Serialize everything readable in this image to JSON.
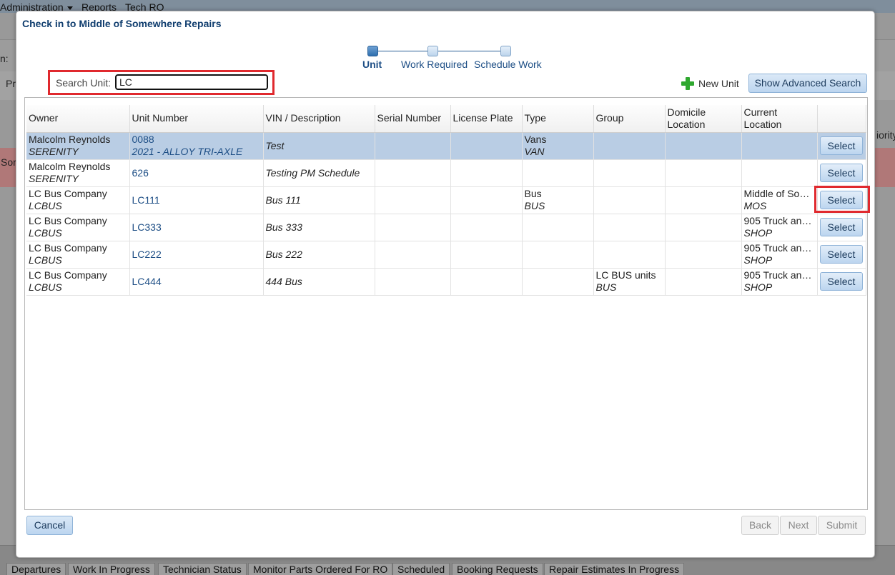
{
  "background": {
    "menu": [
      "Administration",
      "Reports",
      "Tech RO"
    ],
    "left_fragments": [
      "n:",
      "Pri",
      "Sor"
    ],
    "right_fragment": "iority",
    "bottom_tabs": [
      "Departures",
      "Work In Progress",
      "Technician Status",
      "Monitor Parts Ordered For RO",
      "Scheduled",
      "Booking Requests",
      "Repair Estimates In Progress"
    ]
  },
  "dialog": {
    "title": "Check in to Middle of Somewhere Repairs",
    "steps": [
      "Unit",
      "Work Required",
      "Schedule Work"
    ],
    "active_step": 0,
    "search": {
      "label": "Search Unit:",
      "value": "LC"
    },
    "new_unit_label": "New Unit",
    "advanced_search_label": "Show Advanced Search",
    "columns": [
      "Owner",
      "Unit Number",
      "VIN / Description",
      "Serial Number",
      "License Plate",
      "Type",
      "Group",
      "Domicile Location",
      "Current Location",
      ""
    ],
    "rows": [
      {
        "owner": "Malcolm Reynolds",
        "owner_code": "SERENITY",
        "unit": "0088",
        "unit_sub": "2021 - ALLOY TRI-AXLE",
        "vin": "Test",
        "serial": "",
        "plate": "",
        "type": "Vans",
        "type_code": "VAN",
        "group": "",
        "group_code": "",
        "domicile": "",
        "location": "",
        "location_code": "",
        "select": "Select"
      },
      {
        "owner": "Malcolm Reynolds",
        "owner_code": "SERENITY",
        "unit": "626",
        "unit_sub": "",
        "vin": "Testing PM Schedule",
        "serial": "",
        "plate": "",
        "type": "",
        "type_code": "",
        "group": "",
        "group_code": "",
        "domicile": "",
        "location": "",
        "location_code": "",
        "select": "Select"
      },
      {
        "owner": "LC Bus Company",
        "owner_code": "LCBUS",
        "unit": "LC111",
        "unit_sub": "",
        "vin": "Bus 111",
        "serial": "",
        "plate": "",
        "type": "Bus",
        "type_code": "BUS",
        "group": "",
        "group_code": "",
        "domicile": "",
        "location": "Middle of Som...",
        "location_code": "MOS",
        "select": "Select"
      },
      {
        "owner": "LC Bus Company",
        "owner_code": "LCBUS",
        "unit": "LC333",
        "unit_sub": "",
        "vin": "Bus 333",
        "serial": "",
        "plate": "",
        "type": "",
        "type_code": "",
        "group": "",
        "group_code": "",
        "domicile": "",
        "location": "905 Truck and...",
        "location_code": "SHOP",
        "select": "Select"
      },
      {
        "owner": "LC Bus Company",
        "owner_code": "LCBUS",
        "unit": "LC222",
        "unit_sub": "",
        "vin": "Bus 222",
        "serial": "",
        "plate": "",
        "type": "",
        "type_code": "",
        "group": "",
        "group_code": "",
        "domicile": "",
        "location": "905 Truck and...",
        "location_code": "SHOP",
        "select": "Select"
      },
      {
        "owner": "LC Bus Company",
        "owner_code": "LCBUS",
        "unit": "LC444",
        "unit_sub": "",
        "vin": "444 Bus",
        "serial": "",
        "plate": "",
        "type": "",
        "type_code": "",
        "group": "LC BUS units",
        "group_code": "BUS",
        "domicile": "",
        "location": "905 Truck and...",
        "location_code": "SHOP",
        "select": "Select"
      }
    ],
    "buttons": {
      "cancel": "Cancel",
      "back": "Back",
      "next": "Next",
      "submit": "Submit"
    }
  }
}
